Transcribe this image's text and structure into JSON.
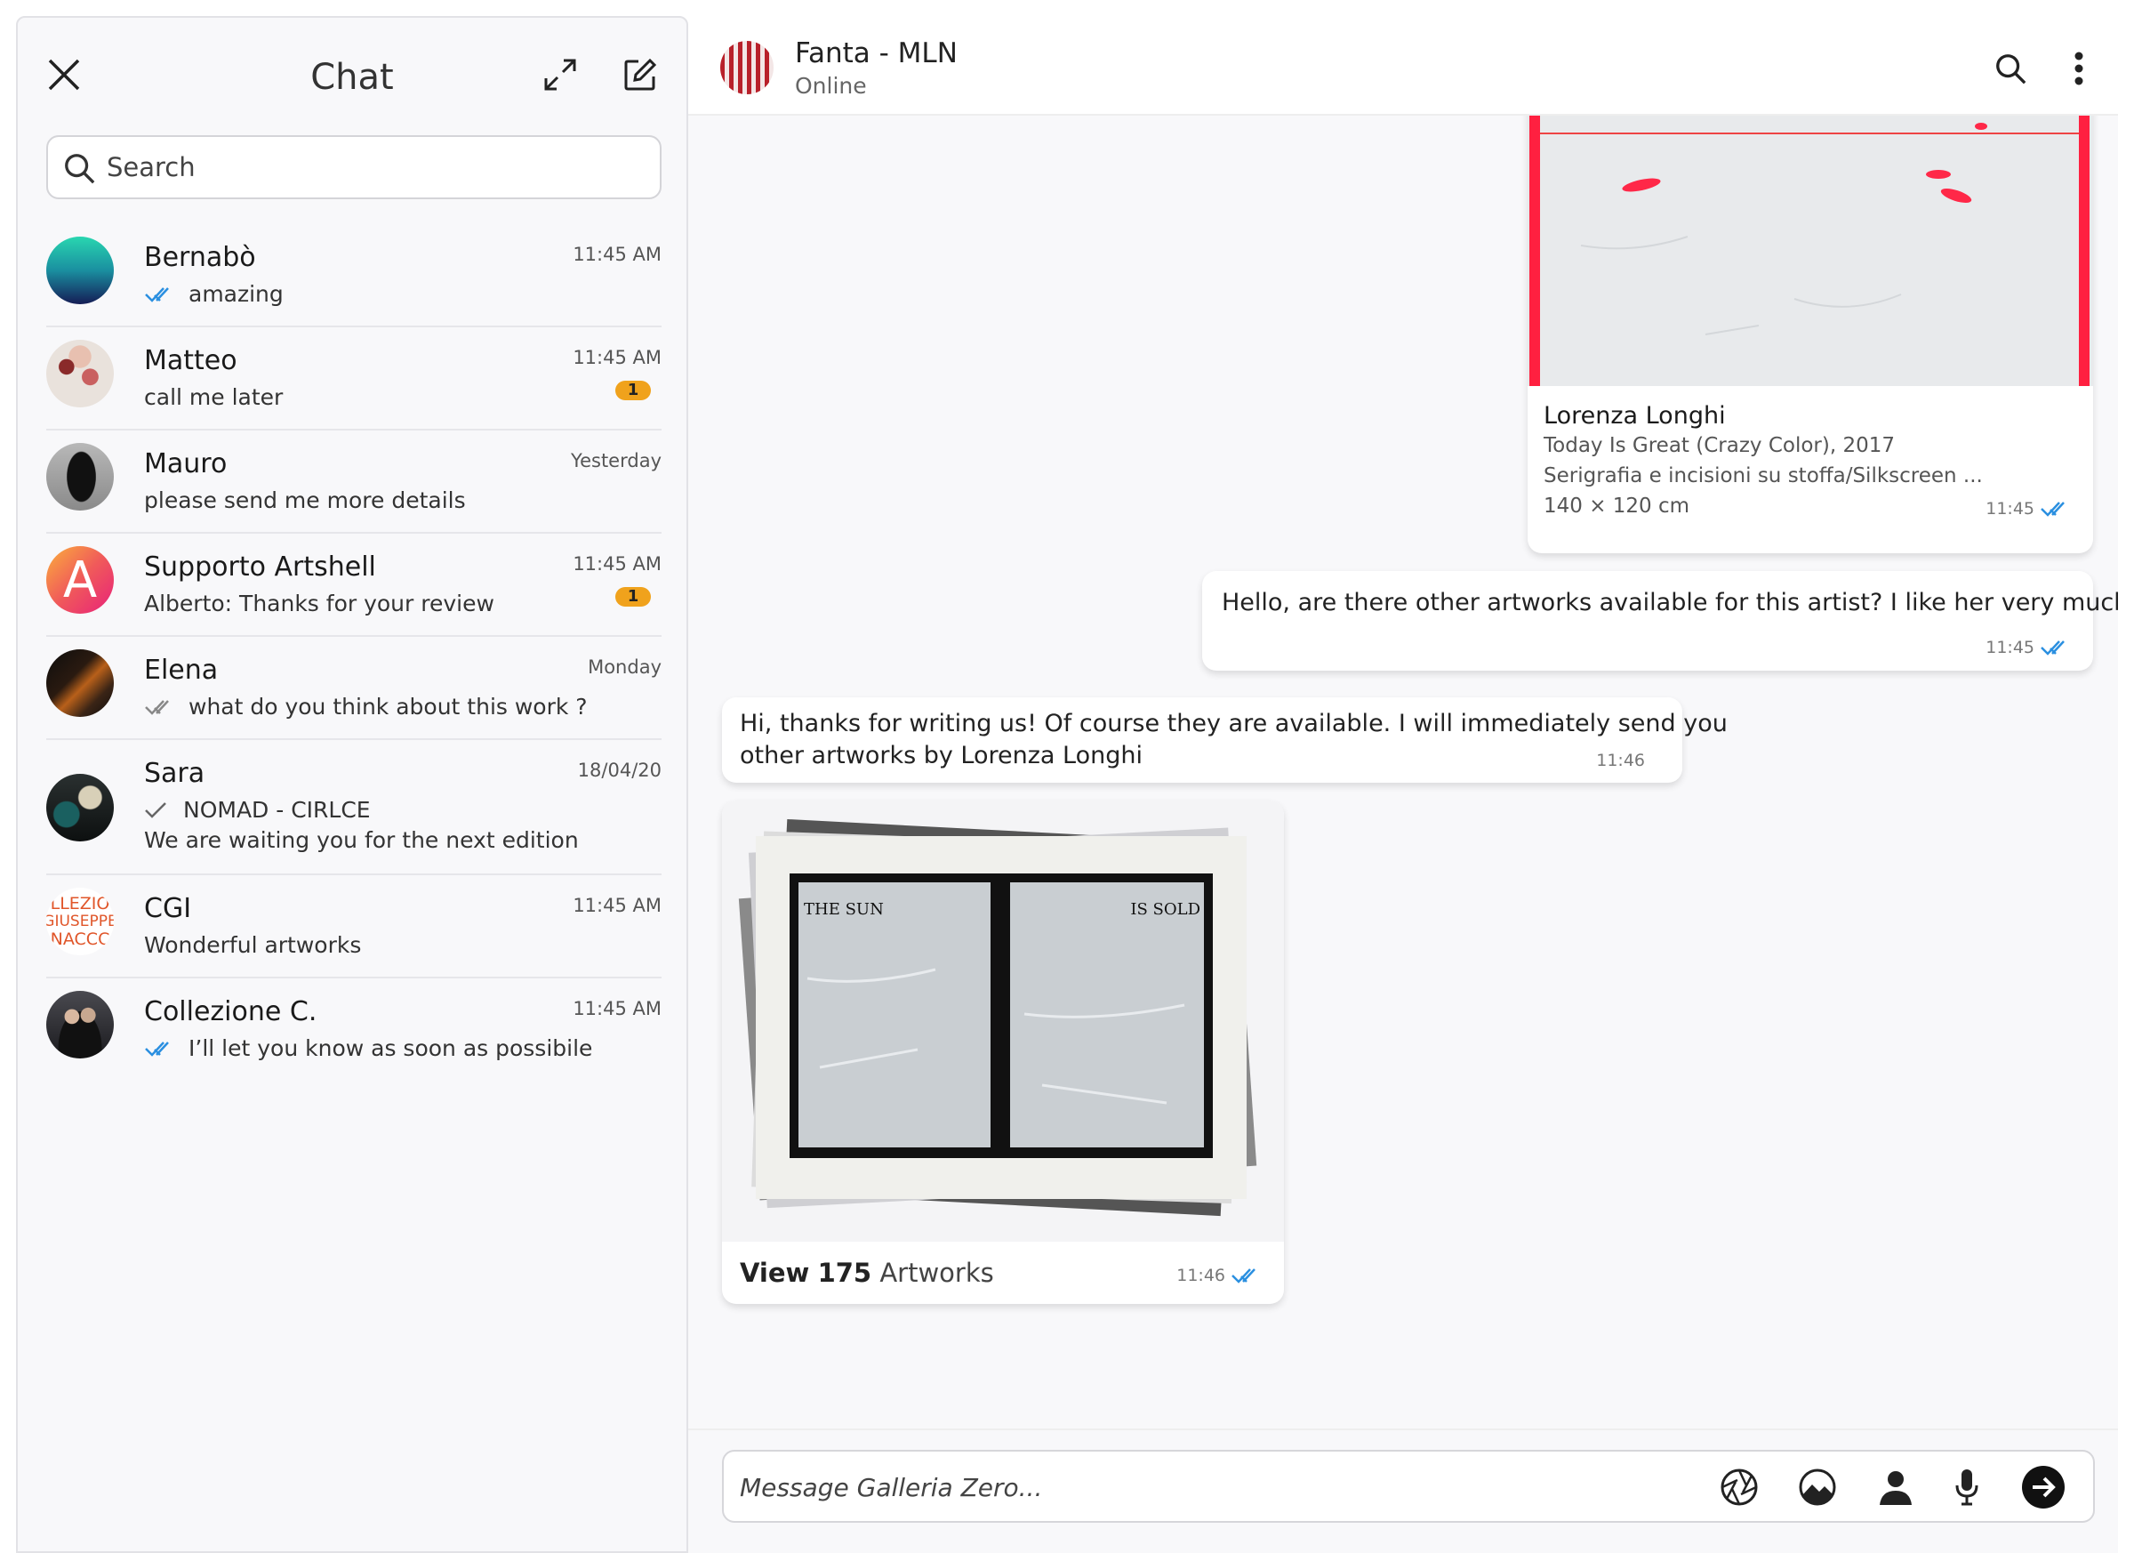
{
  "sidebar": {
    "title": "Chat",
    "search_placeholder": "Search",
    "chats": [
      {
        "name": "Bernabò",
        "time": "11:45 AM",
        "message": "amazing",
        "ticks": "read"
      },
      {
        "name": "Matteo",
        "time": "11:45 AM",
        "message": "call me later",
        "badge": "1"
      },
      {
        "name": "Mauro",
        "time": "Yesterday",
        "message": "please send me more details"
      },
      {
        "name": "Supporto Artshell",
        "time": "11:45 AM",
        "message": "Alberto: Thanks for your review",
        "badge": "1",
        "avatar_letter": "A"
      },
      {
        "name": "Elena",
        "time": "Monday",
        "message": "what do you think about this work ?",
        "ticks": "delivered"
      },
      {
        "name": "Sara",
        "time": "18/04/20",
        "message": "NOMAD - CIRLCE",
        "message2": "We are waiting you for the next edition",
        "ticks": "sent"
      },
      {
        "name": "CGI",
        "time": "11:45 AM",
        "message": "Wonderful artworks",
        "avatar_text": [
          "LLEZIO",
          "GIUSEPPE",
          "NACCC"
        ]
      },
      {
        "name": "Collezione C.",
        "time": "11:45 AM",
        "message": "I’ll let you know as soon as possibile",
        "ticks": "read"
      }
    ]
  },
  "conversation": {
    "name": "Fanta - MLN",
    "status": "Online",
    "artwork": {
      "artist": "Lorenza Longhi",
      "title": "Today Is Great (Crazy Color), 2017",
      "medium": "Serigrafia e incisioni su stoffa/Silkscreen ...",
      "size": "140 × 120 cm",
      "time": "11:45"
    },
    "outgoing": {
      "text": "Hello, are there other artworks available for this artist? I like her very much",
      "time": "11:45"
    },
    "incoming": {
      "line1": "Hi, thanks for writing us! Of course they are available. I will immediately send you",
      "line2": "other artworks by Lorenza Longhi",
      "time": "11:46"
    },
    "collection": {
      "view_label": "View",
      "count": "175",
      "unit": "Artworks",
      "time": "11:46",
      "artwork_text_left": "THE SUN",
      "artwork_text_right": "IS SOLD"
    },
    "composer_placeholder": "Message Galleria Zero..."
  },
  "colors": {
    "badge": "#f0a21c",
    "tick_read": "#2a8fe0",
    "tick_unread": "#888888",
    "accent_red": "#e8243c"
  }
}
